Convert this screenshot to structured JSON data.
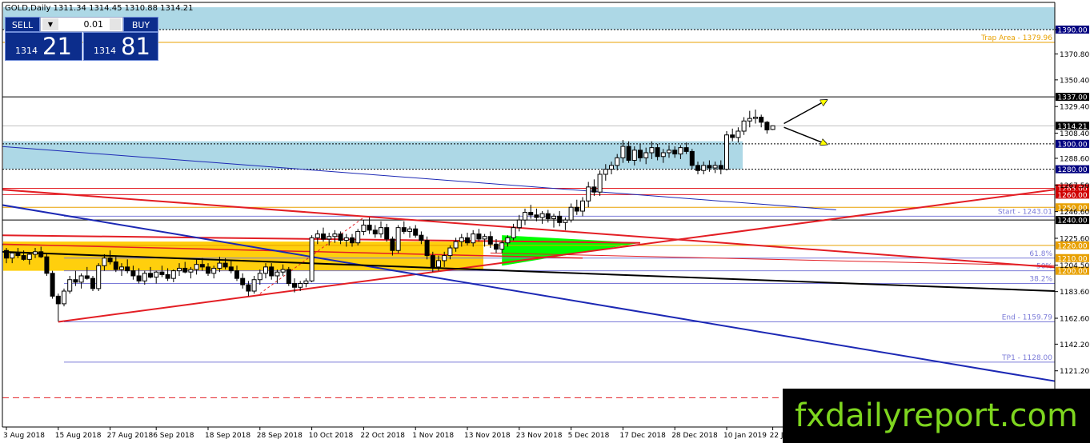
{
  "header": {
    "symbol_line": "GOLD,Daily  1311.34 1314.45 1310.88 1314.21"
  },
  "trade_panel": {
    "sell_label": "SELL",
    "buy_label": "BUY",
    "lot_size": "0.01",
    "lot_arrow": "▼",
    "sell_price_small": "1314",
    "sell_price_big": "21",
    "buy_price_small": "1314",
    "buy_price_big": "81"
  },
  "watermark": "fxdailyreport.com",
  "colors": {
    "zone_blue": "#add8e6",
    "zone_yellow": "#ffcc00",
    "triangle_green": "#00ff00",
    "red_line": "#e31e24",
    "blue_line": "#1c28b4",
    "black_line": "#000000",
    "level_lavender": "#7b7bd8",
    "trap_orange": "#e8a000",
    "tag_navy": "#000080",
    "tag_red": "#d00000",
    "tag_orange": "#e8a000",
    "tag_black": "#000000",
    "arrow_yellow": "#ffff00"
  },
  "chart_data": {
    "type": "candlestick",
    "symbol": "GOLD",
    "timeframe": "Daily",
    "ohlc_current": {
      "open": 1311.34,
      "high": 1314.45,
      "low": 1310.88,
      "close": 1314.21
    },
    "ylim": [
      1101.6,
      1407.6
    ],
    "y_ticks": [
      1162.6,
      1183.6,
      1204.5,
      1225.6,
      1246.6,
      1267.5,
      1288.6,
      1308.4,
      1329.4,
      1350.4,
      1370.8,
      1390.0,
      1142.2,
      1121.2
    ],
    "x_labels": [
      "3 Aug 2018",
      "15 Aug 2018",
      "27 Aug 2018",
      "6 Sep 2018",
      "18 Sep 2018",
      "28 Sep 2018",
      "10 Oct 2018",
      "22 Oct 2018",
      "1 Nov 2018",
      "13 Nov 2018",
      "23 Nov 2018",
      "5 Dec 2018",
      "17 Dec 2018",
      "28 Dec 2018",
      "10 Jan 2019",
      "22 J"
    ],
    "levels": [
      {
        "price": 1390.0,
        "tag": "1390.00",
        "tag_color": "tag_navy",
        "style": "dotted"
      },
      {
        "price": 1379.96,
        "label": "Trap Area - 1379.96",
        "style": "solid",
        "color": "trap_orange"
      },
      {
        "price": 1337.0,
        "tag": "1337.00",
        "tag_color": "tag_black",
        "style": "solid"
      },
      {
        "price": 1314.21,
        "tag": "1314.21",
        "tag_color": "tag_black",
        "style": "current"
      },
      {
        "price": 1300.0,
        "tag": "1300.00",
        "tag_color": "tag_navy",
        "style": "dotted"
      },
      {
        "price": 1280.0,
        "tag": "1280.00",
        "tag_color": "tag_navy",
        "style": "dotted"
      },
      {
        "price": 1265.0,
        "tag": "1265.00",
        "tag_color": "tag_red",
        "style": "solid_red"
      },
      {
        "price": 1260.0,
        "tag": "1260.00",
        "tag_color": "tag_red",
        "style": "solid_red"
      },
      {
        "price": 1250.0,
        "tag": "1250.00",
        "tag_color": "tag_orange",
        "style": "solid_orange"
      },
      {
        "price": 1243.01,
        "label": "Start - 1243.01",
        "style": "lavender"
      },
      {
        "price": 1240.0,
        "tag": "1240.00",
        "tag_color": "tag_black",
        "style": "solid"
      },
      {
        "price": 1220.0,
        "tag": "1220.00",
        "tag_color": "tag_orange",
        "style": "solid_orange"
      },
      {
        "price": 1210.0,
        "tag": "1210.00",
        "tag_color": "tag_orange",
        "label": "61.8%",
        "style": "lavender"
      },
      {
        "price": 1200.0,
        "tag": "1200.00",
        "tag_color": "tag_orange",
        "label": "50%",
        "style": "lavender"
      },
      {
        "price": 1190.0,
        "label": "38.2%",
        "style": "lavender"
      },
      {
        "price": 1159.79,
        "label": "End - 1159.79",
        "style": "lavender"
      },
      {
        "price": 1128.0,
        "label": "TP1 - 1128.00",
        "style": "lavender"
      },
      {
        "price": 1100.0,
        "style": "dashed_red"
      }
    ],
    "zones": [
      {
        "name": "upper-supply-zone",
        "from": 1390.0,
        "to": 1407.6,
        "x_from": "3 Aug 2018",
        "x_to": "end",
        "color": "zone_blue"
      },
      {
        "name": "resistance-zone",
        "from": 1280.0,
        "to": 1302.0,
        "x_from": "3 Aug 2018",
        "x_to": "10 Jan 2019",
        "color": "zone_blue"
      },
      {
        "name": "support-zone",
        "from": 1200.0,
        "to": 1223.0,
        "x_from": "3 Aug 2018",
        "x_to": "13 Nov 2018",
        "color": "zone_yellow"
      }
    ],
    "candles": [
      [
        1216,
        1218,
        1206,
        1210
      ],
      [
        1210,
        1215,
        1206,
        1214
      ],
      [
        1214,
        1218,
        1210,
        1212
      ],
      [
        1212,
        1216,
        1208,
        1209
      ],
      [
        1209,
        1214,
        1205,
        1213
      ],
      [
        1213,
        1218,
        1210,
        1215
      ],
      [
        1215,
        1219,
        1210,
        1211
      ],
      [
        1211,
        1213,
        1196,
        1198
      ],
      [
        1198,
        1200,
        1178,
        1180
      ],
      [
        1180,
        1182,
        1160,
        1174
      ],
      [
        1174,
        1186,
        1172,
        1184
      ],
      [
        1184,
        1196,
        1182,
        1193
      ],
      [
        1193,
        1200,
        1188,
        1191
      ],
      [
        1191,
        1198,
        1186,
        1196
      ],
      [
        1196,
        1203,
        1193,
        1194
      ],
      [
        1194,
        1196,
        1184,
        1186
      ],
      [
        1186,
        1206,
        1184,
        1204
      ],
      [
        1204,
        1213,
        1200,
        1210
      ],
      [
        1210,
        1216,
        1205,
        1207
      ],
      [
        1207,
        1211,
        1199,
        1201
      ],
      [
        1201,
        1206,
        1196,
        1203
      ],
      [
        1203,
        1209,
        1198,
        1200
      ],
      [
        1200,
        1204,
        1193,
        1196
      ],
      [
        1196,
        1202,
        1190,
        1192
      ],
      [
        1192,
        1200,
        1189,
        1198
      ],
      [
        1198,
        1203,
        1194,
        1195
      ],
      [
        1195,
        1200,
        1190,
        1199
      ],
      [
        1199,
        1204,
        1195,
        1197
      ],
      [
        1197,
        1202,
        1192,
        1194
      ],
      [
        1194,
        1201,
        1191,
        1200
      ],
      [
        1200,
        1206,
        1196,
        1202
      ],
      [
        1202,
        1207,
        1198,
        1199
      ],
      [
        1199,
        1203,
        1194,
        1201
      ],
      [
        1201,
        1209,
        1197,
        1205
      ],
      [
        1205,
        1210,
        1200,
        1203
      ],
      [
        1203,
        1206,
        1196,
        1198
      ],
      [
        1198,
        1204,
        1194,
        1202
      ],
      [
        1202,
        1211,
        1199,
        1206
      ],
      [
        1206,
        1210,
        1201,
        1203
      ],
      [
        1203,
        1208,
        1198,
        1200
      ],
      [
        1200,
        1204,
        1192,
        1194
      ],
      [
        1194,
        1198,
        1186,
        1189
      ],
      [
        1189,
        1192,
        1180,
        1184
      ],
      [
        1184,
        1196,
        1182,
        1193
      ],
      [
        1193,
        1201,
        1189,
        1198
      ],
      [
        1198,
        1206,
        1194,
        1203
      ],
      [
        1203,
        1206,
        1193,
        1196
      ],
      [
        1196,
        1201,
        1190,
        1199
      ],
      [
        1199,
        1205,
        1196,
        1201
      ],
      [
        1201,
        1203,
        1188,
        1190
      ],
      [
        1190,
        1194,
        1183,
        1187
      ],
      [
        1187,
        1192,
        1184,
        1190
      ],
      [
        1190,
        1194,
        1187,
        1192
      ],
      [
        1192,
        1228,
        1191,
        1226
      ],
      [
        1226,
        1232,
        1221,
        1229
      ],
      [
        1229,
        1234,
        1223,
        1225
      ],
      [
        1225,
        1230,
        1220,
        1227
      ],
      [
        1227,
        1232,
        1222,
        1229
      ],
      [
        1229,
        1231,
        1221,
        1224
      ],
      [
        1224,
        1229,
        1219,
        1226
      ],
      [
        1226,
        1229,
        1219,
        1222
      ],
      [
        1222,
        1233,
        1220,
        1231
      ],
      [
        1231,
        1240,
        1228,
        1236
      ],
      [
        1236,
        1242,
        1229,
        1232
      ],
      [
        1232,
        1236,
        1226,
        1229
      ],
      [
        1229,
        1239,
        1226,
        1234
      ],
      [
        1234,
        1237,
        1223,
        1225
      ],
      [
        1225,
        1227,
        1212,
        1216
      ],
      [
        1216,
        1236,
        1214,
        1234
      ],
      [
        1234,
        1239,
        1229,
        1231
      ],
      [
        1231,
        1235,
        1226,
        1233
      ],
      [
        1233,
        1236,
        1226,
        1228
      ],
      [
        1228,
        1231,
        1221,
        1224
      ],
      [
        1224,
        1227,
        1209,
        1212
      ],
      [
        1212,
        1215,
        1199,
        1203
      ],
      [
        1203,
        1212,
        1200,
        1208
      ],
      [
        1208,
        1215,
        1203,
        1212
      ],
      [
        1212,
        1220,
        1209,
        1218
      ],
      [
        1218,
        1226,
        1215,
        1223
      ],
      [
        1223,
        1229,
        1219,
        1226
      ],
      [
        1226,
        1230,
        1220,
        1222
      ],
      [
        1222,
        1232,
        1219,
        1229
      ],
      [
        1229,
        1233,
        1223,
        1225
      ],
      [
        1225,
        1229,
        1219,
        1227
      ],
      [
        1227,
        1231,
        1218,
        1221
      ],
      [
        1221,
        1225,
        1214,
        1217
      ],
      [
        1217,
        1224,
        1214,
        1222
      ],
      [
        1222,
        1228,
        1219,
        1226
      ],
      [
        1226,
        1237,
        1224,
        1234
      ],
      [
        1234,
        1244,
        1231,
        1240
      ],
      [
        1240,
        1249,
        1236,
        1246
      ],
      [
        1246,
        1252,
        1241,
        1244
      ],
      [
        1244,
        1249,
        1239,
        1242
      ],
      [
        1242,
        1247,
        1237,
        1245
      ],
      [
        1245,
        1248,
        1238,
        1241
      ],
      [
        1241,
        1245,
        1234,
        1243
      ],
      [
        1243,
        1247,
        1235,
        1238
      ],
      [
        1238,
        1242,
        1232,
        1240
      ],
      [
        1240,
        1253,
        1238,
        1250
      ],
      [
        1250,
        1256,
        1244,
        1247
      ],
      [
        1247,
        1258,
        1243,
        1255
      ],
      [
        1255,
        1270,
        1250,
        1266
      ],
      [
        1266,
        1272,
        1259,
        1262
      ],
      [
        1262,
        1279,
        1259,
        1276
      ],
      [
        1276,
        1284,
        1271,
        1280
      ],
      [
        1280,
        1286,
        1276,
        1283
      ],
      [
        1283,
        1292,
        1279,
        1289
      ],
      [
        1289,
        1303,
        1285,
        1298
      ],
      [
        1298,
        1302,
        1285,
        1287
      ],
      [
        1287,
        1298,
        1283,
        1295
      ],
      [
        1295,
        1300,
        1286,
        1289
      ],
      [
        1289,
        1297,
        1284,
        1293
      ],
      [
        1293,
        1302,
        1288,
        1297
      ],
      [
        1297,
        1300,
        1287,
        1290
      ],
      [
        1290,
        1296,
        1285,
        1293
      ],
      [
        1293,
        1299,
        1289,
        1295
      ],
      [
        1295,
        1298,
        1289,
        1292
      ],
      [
        1292,
        1299,
        1288,
        1297
      ],
      [
        1297,
        1301,
        1292,
        1294
      ],
      [
        1294,
        1296,
        1280,
        1283
      ],
      [
        1283,
        1286,
        1276,
        1279
      ],
      [
        1279,
        1286,
        1276,
        1283
      ],
      [
        1283,
        1287,
        1278,
        1281
      ],
      [
        1281,
        1286,
        1277,
        1283
      ],
      [
        1283,
        1287,
        1276,
        1280
      ],
      [
        1280,
        1310,
        1279,
        1307
      ],
      [
        1307,
        1312,
        1302,
        1305
      ],
      [
        1305,
        1313,
        1301,
        1310
      ],
      [
        1310,
        1321,
        1307,
        1318
      ],
      [
        1318,
        1326,
        1313,
        1320
      ],
      [
        1320,
        1327,
        1316,
        1321
      ],
      [
        1321,
        1323,
        1313,
        1317
      ],
      [
        1317,
        1318,
        1308,
        1311
      ],
      [
        1311.34,
        1314.45,
        1310.88,
        1314.21
      ]
    ],
    "annotations": [
      "Trap Area - 1379.96",
      "Start - 1243.01",
      "61.8%",
      "50%",
      "38.2%",
      "End - 1159.79",
      "TP1 - 1128.00"
    ]
  }
}
